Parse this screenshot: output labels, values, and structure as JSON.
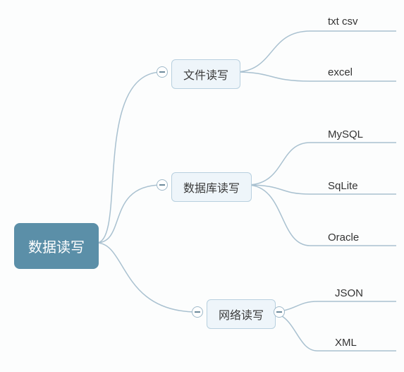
{
  "root": {
    "label": "数据读写"
  },
  "branches": [
    {
      "key": "file",
      "label": "文件读写",
      "leaves": [
        "txt   csv",
        "excel"
      ]
    },
    {
      "key": "db",
      "label": "数据库读写",
      "leaves": [
        "MySQL",
        "SqLite",
        "Oracle"
      ]
    },
    {
      "key": "net",
      "label": "网络读写",
      "leaves": [
        "JSON",
        "XML"
      ]
    }
  ],
  "colors": {
    "root_bg": "#5b8fa8",
    "branch_bg": "#eef5fa",
    "line": "#a9c1d0"
  }
}
